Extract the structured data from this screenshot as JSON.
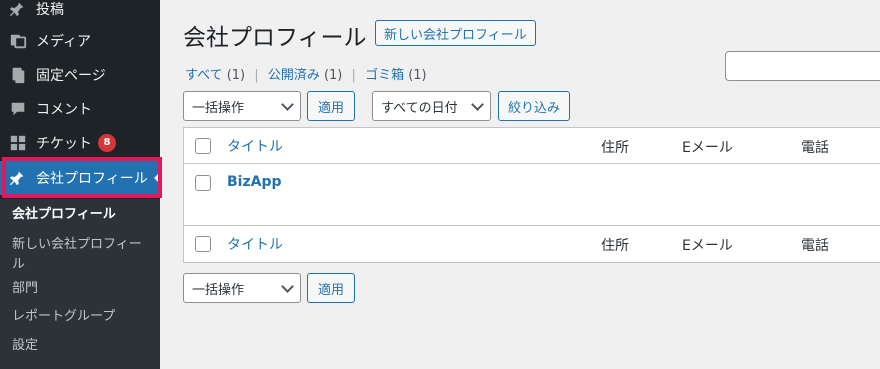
{
  "sidebar": {
    "items": [
      {
        "label": "投稿",
        "icon": "pin-icon"
      },
      {
        "label": "メディア",
        "icon": "media-icon"
      },
      {
        "label": "固定ページ",
        "icon": "page-icon"
      },
      {
        "label": "コメント",
        "icon": "comment-icon"
      },
      {
        "label": "チケット",
        "icon": "grid-icon",
        "badge": "8"
      },
      {
        "label": "会社プロフィール",
        "icon": "pin-icon",
        "active": true
      }
    ],
    "submenu": [
      {
        "label": "会社プロフィール",
        "current": true
      },
      {
        "label": "新しい会社プロフィー\nル"
      },
      {
        "label": "部門"
      },
      {
        "label": "レポートグループ"
      },
      {
        "label": "設定"
      }
    ]
  },
  "header": {
    "title": "会社プロフィール",
    "add_new": "新しい会社プロフィール"
  },
  "filters": {
    "all": "すべて",
    "all_count": "(1)",
    "published": "公開済み",
    "published_count": "(1)",
    "trash": "ゴミ箱",
    "trash_count": "(1)",
    "sep": "|"
  },
  "toolbar": {
    "bulk_action": "一括操作",
    "apply": "適用",
    "date_filter": "すべての日付",
    "filter_button": "絞り込み"
  },
  "table": {
    "columns": [
      "タイトル",
      "住所",
      "Eメール",
      "電話"
    ],
    "rows": [
      {
        "title": "BizApp"
      }
    ]
  },
  "colors": {
    "accent": "#2271b1",
    "highlight": "#e2185b",
    "sidebar_bg": "#1d2327",
    "badge": "#d63638"
  }
}
